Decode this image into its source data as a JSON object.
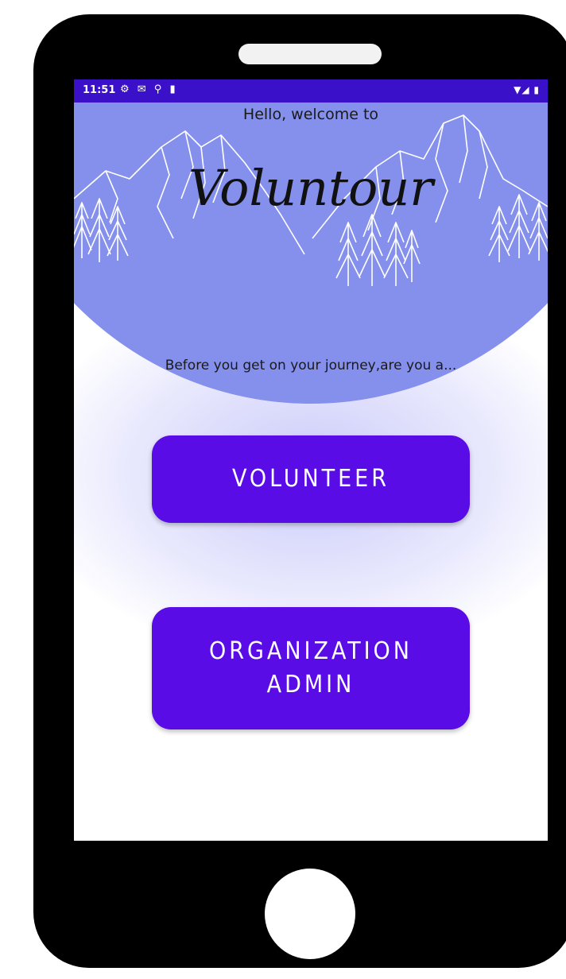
{
  "status_bar": {
    "time": "11:51",
    "left_icons": "⚙ ✉ ⚲ ▮",
    "right_icons": "▼◢ ▮"
  },
  "header": {
    "welcome": "Hello, welcome to",
    "app_name": "Voluntour"
  },
  "prompt": "Before you get on your journey,are you a...",
  "buttons": {
    "volunteer": "VOLUNTEER",
    "organization_admin": "ORGANIZATION\nADMIN"
  },
  "colors": {
    "status_bar": "#3b10c9",
    "header_bg": "#8590ec",
    "button": "#5a0ce6",
    "button_text": "#ffffff"
  },
  "icons": {
    "status_left": [
      "settings-icon",
      "gmail-icon",
      "vpn-key-icon",
      "sd-card-icon"
    ],
    "status_right": [
      "wifi-icon",
      "signal-icon",
      "battery-icon"
    ]
  }
}
